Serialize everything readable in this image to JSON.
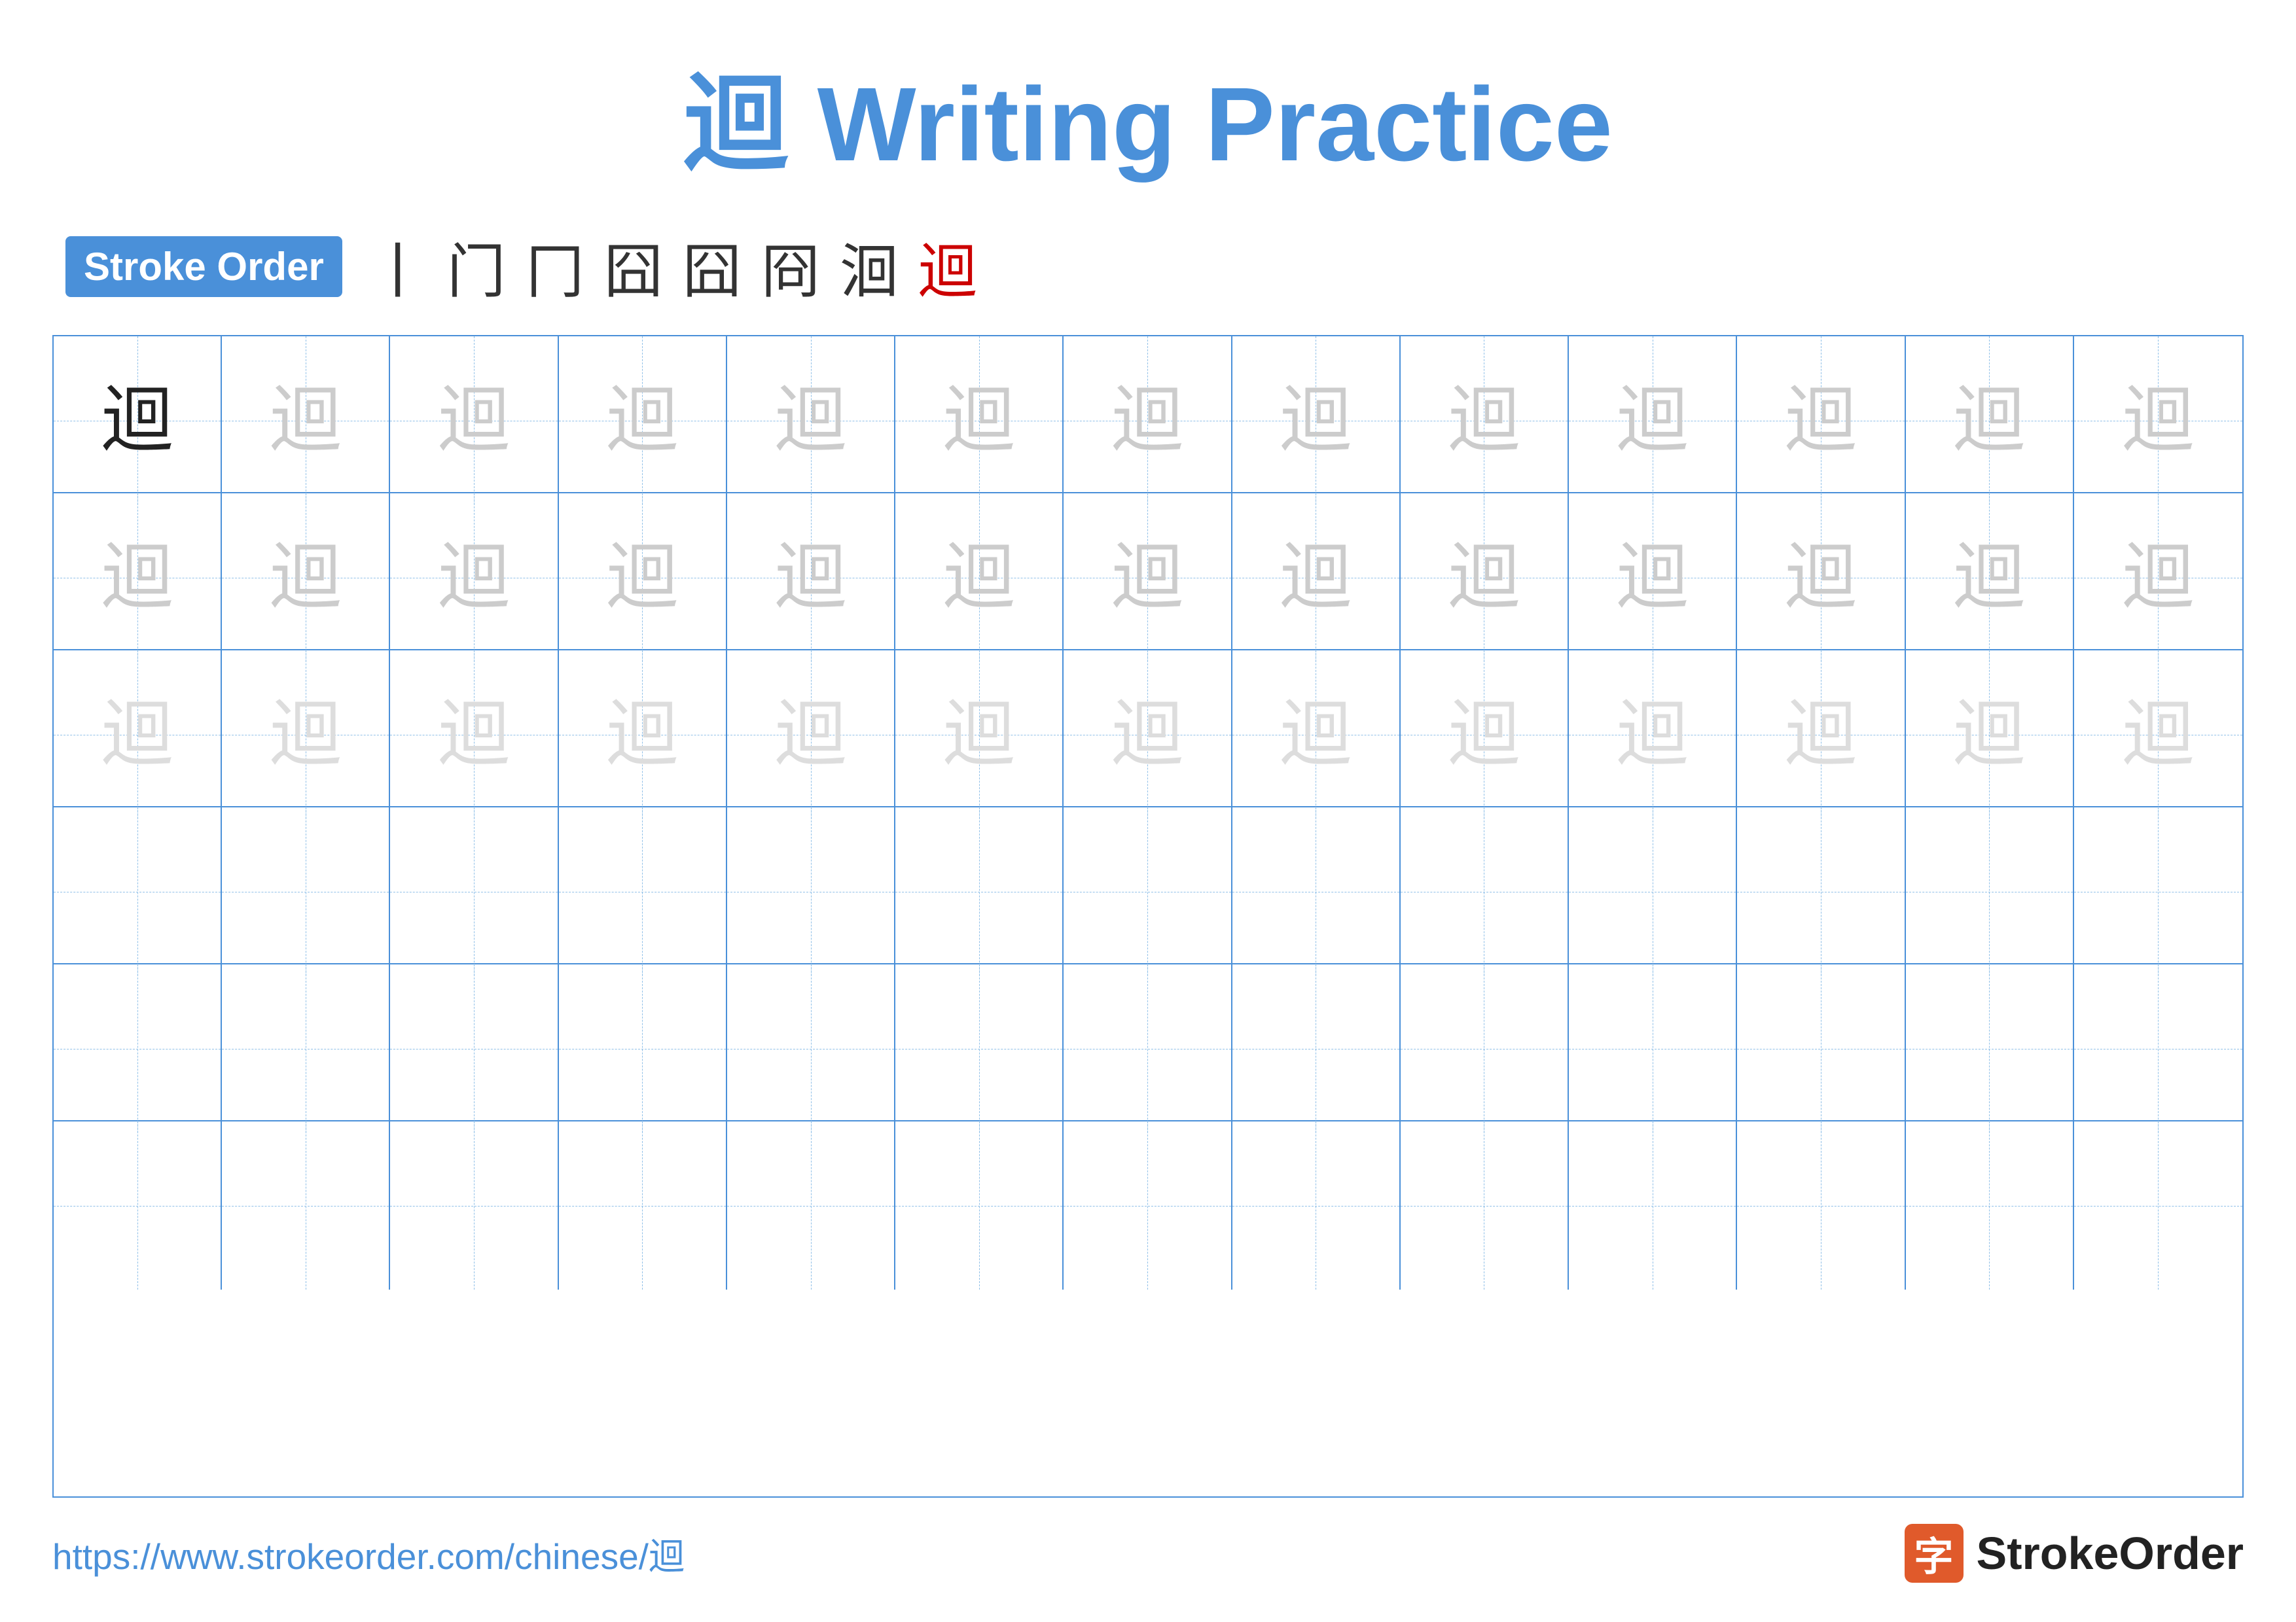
{
  "title": {
    "char": "迴",
    "text": "Writing Practice"
  },
  "stroke_order": {
    "badge_label": "Stroke Order",
    "strokes": [
      "丨",
      "门",
      "冂",
      "冂",
      "囧",
      "冏",
      "洄",
      "迴"
    ]
  },
  "grid": {
    "rows": [
      {
        "type": "dark-then-medium",
        "cells": [
          "dark",
          "medium",
          "medium",
          "medium",
          "medium",
          "medium",
          "medium",
          "medium",
          "medium",
          "medium",
          "medium",
          "medium",
          "medium"
        ]
      },
      {
        "type": "medium",
        "cells": [
          "medium",
          "medium",
          "medium",
          "medium",
          "medium",
          "medium",
          "medium",
          "medium",
          "medium",
          "medium",
          "medium",
          "medium",
          "medium"
        ]
      },
      {
        "type": "light",
        "cells": [
          "light",
          "light",
          "light",
          "light",
          "light",
          "light",
          "light",
          "light",
          "light",
          "light",
          "light",
          "light",
          "light"
        ]
      },
      {
        "type": "empty",
        "cells": [
          "",
          "",
          "",
          "",
          "",
          "",
          "",
          "",
          "",
          "",
          "",
          "",
          ""
        ]
      },
      {
        "type": "empty",
        "cells": [
          "",
          "",
          "",
          "",
          "",
          "",
          "",
          "",
          "",
          "",
          "",
          "",
          ""
        ]
      },
      {
        "type": "empty",
        "cells": [
          "",
          "",
          "",
          "",
          "",
          "",
          "",
          "",
          "",
          "",
          "",
          "",
          ""
        ]
      }
    ],
    "char": "迴"
  },
  "footer": {
    "url": "https://www.strokeorder.com/chinese/迴",
    "logo_char": "字",
    "logo_name": "StrokeOrder"
  }
}
